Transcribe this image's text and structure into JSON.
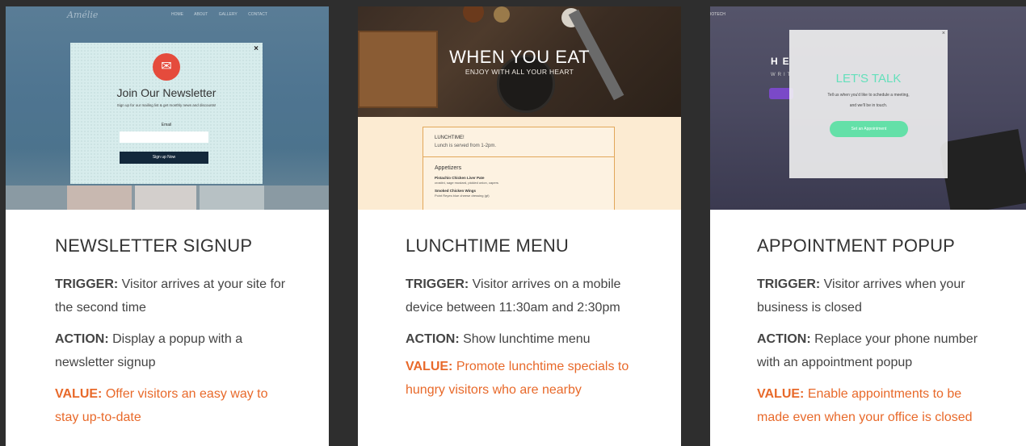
{
  "cards": [
    {
      "title": "NEWSLETTER SIGNUP",
      "trigger_label": "TRIGGER:",
      "trigger_text": "Visitor arrives at your site for the second time",
      "action_label": "ACTION:",
      "action_text": "Display a popup with a newsletter signup",
      "value_label": "VALUE:",
      "value_text": "Offer visitors an easy way to stay up-to-date",
      "thumbnail": {
        "logo": "Amélie",
        "nav": [
          "HOME",
          "ABOUT",
          "GALLERY",
          "CONTACT"
        ],
        "close": "×",
        "popup_title": "Join Our Newsletter",
        "popup_subtitle": "Sign up for our mailing list & get monthly news and discounts!",
        "email_label": "Email",
        "button": "Sign up Now"
      }
    },
    {
      "title": "LUNCHTIME MENU",
      "trigger_label": "TRIGGER:",
      "trigger_text": "Visitor arrives on a mobile device between 11:30am and 2:30pm",
      "action_label": "ACTION:",
      "action_text": "Show lunchtime menu",
      "value_label": "VALUE:",
      "value_text": "Promote lunchtime specials to hungry visitors who are nearby",
      "thumbnail": {
        "headline": "WHEN YOU EAT",
        "subheadline": "ENJOY WITH ALL YOUR HEART",
        "menu_heading": "LUNCHTIME!",
        "menu_hours": "Lunch is served from 1-2pm.",
        "section": "Appetizers",
        "item1_name": "Pistachio Chicken Liver Pate",
        "item1_desc": "crostini, sage mustard, pickled onion, capers",
        "item2_name": "Smoked Chicken Wings",
        "item2_desc": "Point Reyes blue cheese dressing (gf)"
      }
    },
    {
      "title": "APPOINTMENT POPUP",
      "trigger_label": "TRIGGER:",
      "trigger_text": "Visitor arrives when your business is closed",
      "action_label": "ACTION:",
      "action_text": "Replace your phone number with an appointment popup",
      "value_label": "VALUE:",
      "value_text": "Enable appointments to be made even when your office is closed",
      "thumbnail": {
        "logo": "IOTECH",
        "hero_big": "HE",
        "hero_small": "WRIT",
        "close": "×",
        "popup_title": "LET'S TALK",
        "popup_line1": "Tell us when you'd like to schedule a meeting,",
        "popup_line2": "and we'll be in touch.",
        "button": "Set an Appointment"
      }
    }
  ],
  "colors": {
    "value_accent": "#e8692a",
    "page_background": "#2e2e2e",
    "newsletter_badge": "#e54b3c",
    "appointment_accent": "#64e0bb"
  }
}
